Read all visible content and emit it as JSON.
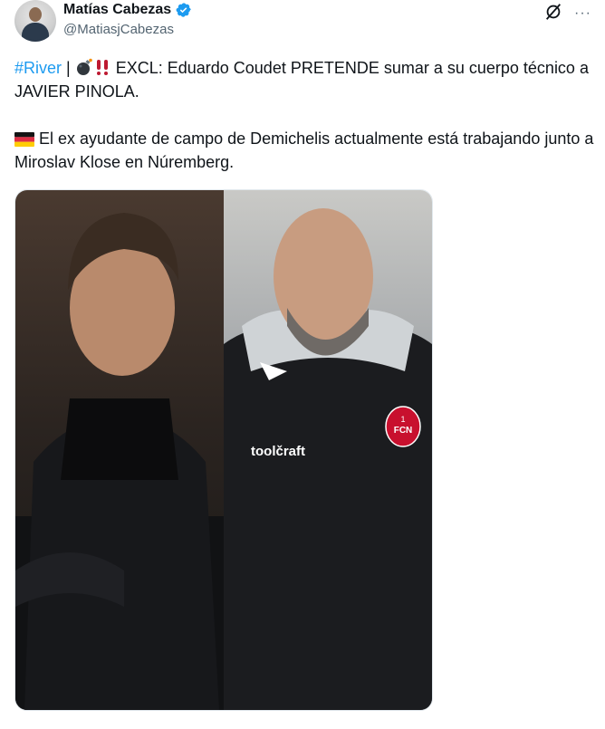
{
  "author": {
    "name": "Matías Cabezas",
    "handle": "@MatiasjCabezas",
    "verified": true
  },
  "tweet": {
    "hashtag": "#River",
    "separator": " | ",
    "line1": " EXCL: Eduardo Coudet PRETENDE sumar a su cuerpo técnico a JAVIER PINOLA.",
    "line2": " El ex ayudante de campo de Demichelis actualmente está trabajando junto a Miroslav Klose en Núremberg."
  },
  "media": {
    "brand_text": "toolčraft",
    "badge_text": "FCN",
    "badge_number": "1"
  },
  "colors": {
    "link": "#1d9bf0",
    "verified": "#1d9bf0",
    "secondary_text": "#536471"
  },
  "icons": {
    "verified": "verified-badge-icon",
    "grok": "grok-icon",
    "more": "more-options-icon"
  }
}
